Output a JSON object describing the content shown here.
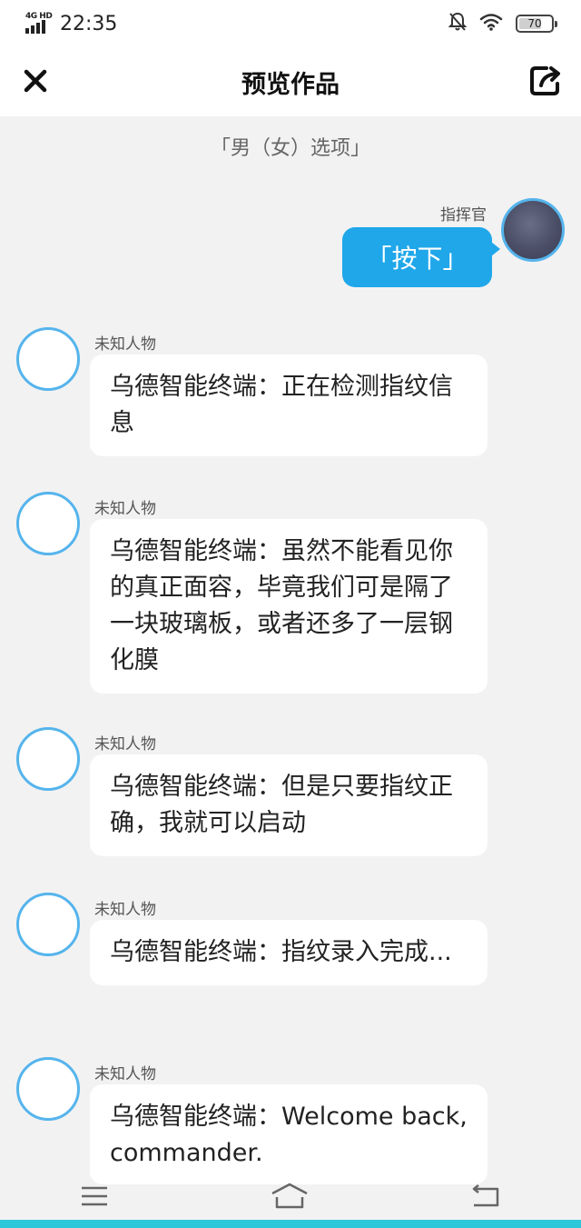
{
  "status_bar": {
    "network": "4G HD",
    "time": "22:35",
    "battery": "70",
    "battery_level": 0.7
  },
  "header": {
    "title": "预览作品",
    "close_icon": "close-icon",
    "share_icon": "share-icon"
  },
  "section_title": "「男（女）选项」",
  "self_message": {
    "name": "指挥官",
    "text": "「按下」"
  },
  "messages": [
    {
      "name": "未知人物",
      "text": "乌德智能终端：正在检测指纹信息"
    },
    {
      "name": "未知人物",
      "text": "乌德智能终端：虽然不能看见你的真正面容，毕竟我们可是隔了一块玻璃板，或者还多了一层钢化膜"
    },
    {
      "name": "未知人物",
      "text": "乌德智能终端：但是只要指纹正确，我就可以启动"
    },
    {
      "name": "未知人物",
      "text": "乌德智能终端：指纹录入完成..."
    },
    {
      "name": "未知人物",
      "text": "乌德智能终端：Welcome back, commander."
    }
  ],
  "nav_bar": {
    "menu_icon": "menu-icon",
    "home_icon": "home-icon",
    "back_icon": "back-icon"
  },
  "colors": {
    "accent": "#1fa7ea",
    "avatar_border": "#55b4ec",
    "bottom_accent": "#2cc7d9",
    "background": "#f2f2f2"
  }
}
